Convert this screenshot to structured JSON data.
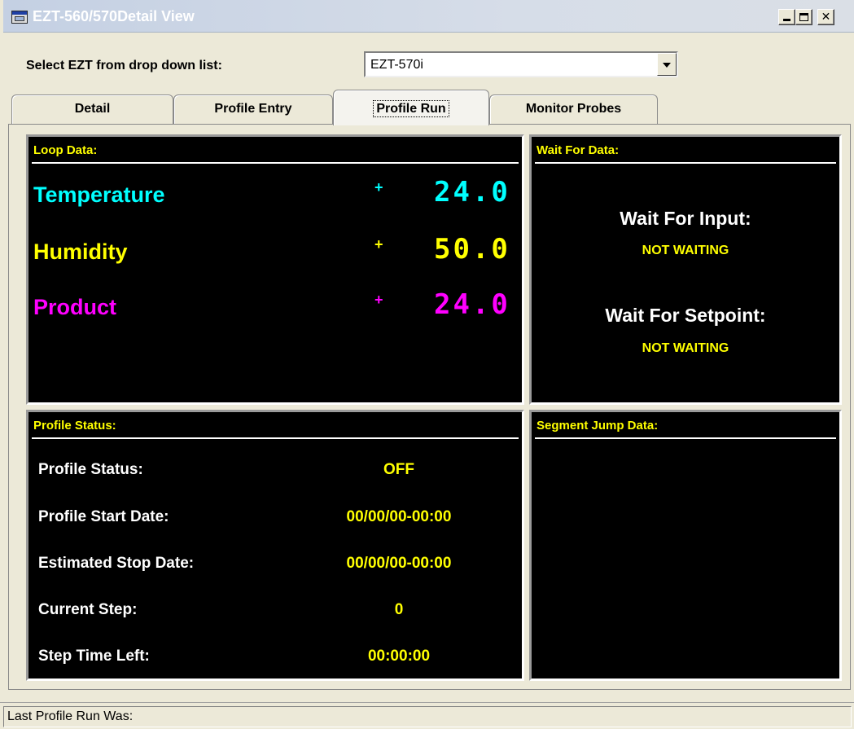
{
  "window": {
    "title": "EZT-560/570Detail View"
  },
  "selector": {
    "label": "Select EZT from drop down list:",
    "value": "EZT-570i"
  },
  "tabs": [
    {
      "label": "Detail"
    },
    {
      "label": "Profile Entry"
    },
    {
      "label": "Profile Run",
      "active": true
    },
    {
      "label": "Monitor Probes"
    }
  ],
  "loop_data": {
    "title": "Loop Data:",
    "items": [
      {
        "name": "Temperature",
        "indicator": "+",
        "value": "24.0",
        "color": "#00ffff"
      },
      {
        "name": "Humidity",
        "indicator": "+",
        "value": "50.0",
        "color": "#ffff00"
      },
      {
        "name": "Product",
        "indicator": "+",
        "value": "24.0",
        "color": "#ff00ff"
      }
    ]
  },
  "wait_for_data": {
    "title": "Wait For Data:",
    "input_label": "Wait For Input:",
    "input_value": "NOT WAITING",
    "setpoint_label": "Wait For Setpoint:",
    "setpoint_value": "NOT WAITING"
  },
  "profile_status": {
    "title": "Profile Status:",
    "rows": [
      {
        "label": "Profile Status:",
        "value": "OFF"
      },
      {
        "label": "Profile Start Date:",
        "value": "00/00/00-00:00"
      },
      {
        "label": "Estimated Stop Date:",
        "value": "00/00/00-00:00"
      },
      {
        "label": "Current Step:",
        "value": "0"
      },
      {
        "label": "Step Time Left:",
        "value": "00:00:00"
      }
    ]
  },
  "segment_jump": {
    "title": "Segment Jump Data:"
  },
  "statusbar": {
    "text": "Last Profile Run Was:"
  }
}
